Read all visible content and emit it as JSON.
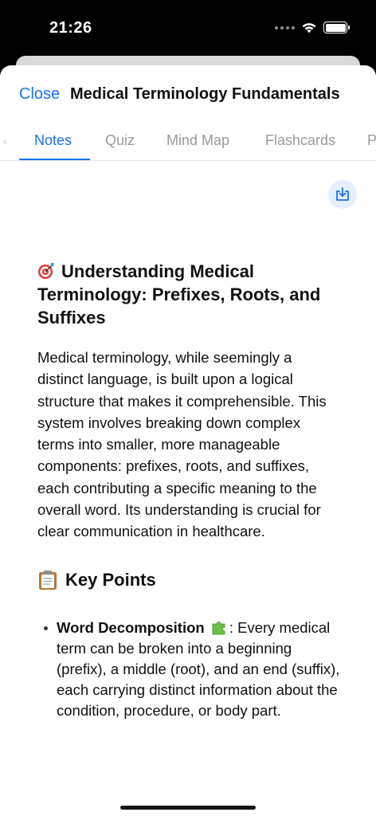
{
  "status_bar": {
    "time": "21:26"
  },
  "header": {
    "close_label": "Close",
    "title": "Medical Terminology Fundamentals"
  },
  "tabs": [
    {
      "label": "Notes",
      "active": true
    },
    {
      "label": "Quiz",
      "active": false
    },
    {
      "label": "Mind Map",
      "active": false
    },
    {
      "label": "Flashcards",
      "active": false
    },
    {
      "label": "P",
      "active": false
    }
  ],
  "icons": {
    "download": "download-tray-icon",
    "heading_emoji": "target-emoji",
    "key_points_emoji": "clipboard-emoji",
    "bullet_emoji": "puzzle-emoji"
  },
  "colors": {
    "accent": "#1a73e8",
    "tab_inactive": "#9a9a9a",
    "download_bg": "#e4effc"
  },
  "content": {
    "heading": "Understanding Medical Terminology: Prefixes, Roots, and Suffixes",
    "intro": "Medical terminology, while seemingly a distinct language, is built upon a logical structure that makes it comprehensible. This system involves breaking down complex terms into smaller, more manageable components: prefixes, roots, and suffixes, each contributing a specific meaning to the overall word. Its understanding is crucial for clear communication in healthcare.",
    "key_points_title": "Key Points",
    "key_points": [
      {
        "title": "Word Decomposition",
        "text": ": Every medical term can be broken into a beginning (prefix), a middle (root), and an end (suffix), each carrying distinct information about the condition, procedure, or body part."
      }
    ]
  }
}
